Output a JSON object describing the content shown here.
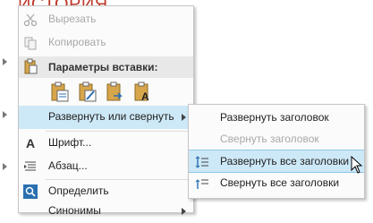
{
  "document": {
    "heading": "ИСТОРИЯ"
  },
  "context_menu": {
    "cut": "Вырезать",
    "copy": "Копировать",
    "paste_options_header": "Параметры вставки:",
    "expand_collapse": "Развернуть или свернуть",
    "font": "Шрифт...",
    "paragraph": "Абзац...",
    "define": "Определить",
    "synonyms": "Синонимы"
  },
  "submenu": {
    "expand_heading": "Развернуть заголовок",
    "collapse_heading": "Свернуть заголовок",
    "expand_all": "Развернуть все заголовки",
    "collapse_all": "Свернуть все заголовки"
  },
  "icons": {
    "cut": "scissors-icon",
    "copy": "copy-icon",
    "paste": "paste-icon",
    "font": "font-icon",
    "paragraph": "paragraph-icon",
    "define": "search-icon"
  },
  "colors": {
    "heading": "#c0392b",
    "highlight": "#cde8f7",
    "disabled": "#a8a8a8"
  }
}
